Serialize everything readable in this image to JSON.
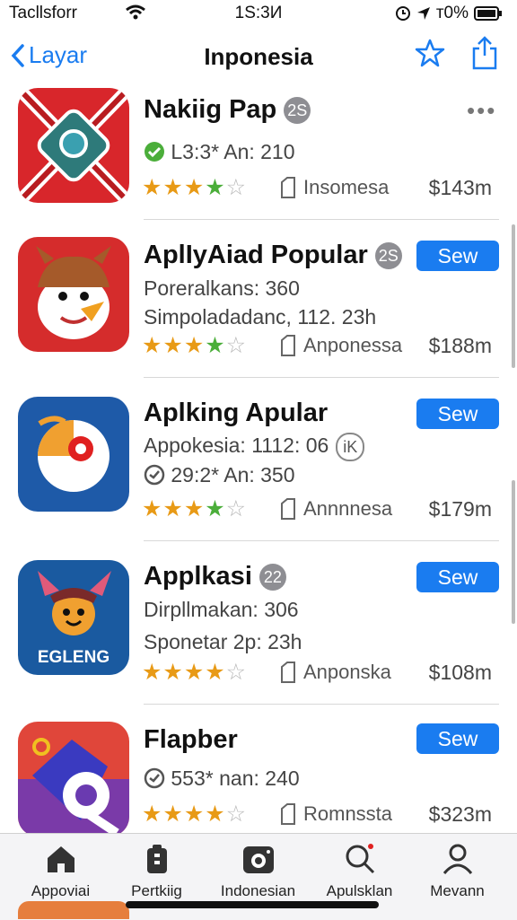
{
  "status": {
    "carrier": "Tacllsforr",
    "time": "1S:3И",
    "battery": "т0%"
  },
  "nav": {
    "back_label": "Layar",
    "title": "Inponesia"
  },
  "apps": [
    {
      "name": "Nakiig Pap",
      "badge": "2S",
      "line1": "L3:3*  An: 210",
      "developer": "Insomesa",
      "price": "$143m",
      "stars": 4
    },
    {
      "name": "AplIyAiad Popular",
      "badge": "2S",
      "line1": "Poreralkans: 360",
      "line2": "Simpoladadanc, 112. 23h",
      "developer": "Anponessa",
      "price": "$188m",
      "stars": 4,
      "get": "Sew"
    },
    {
      "name": "Aplking Apular",
      "badge": "iK",
      "line1": "Appokesia: 1112: 06",
      "line2": "29:2*  An: 350",
      "developer": "Annnnesa",
      "price": "$179m",
      "stars": 4,
      "get": "Sew"
    },
    {
      "name": "Applkasi",
      "badge": "22",
      "line1": "Dirpllmakan: 306",
      "line2": "Sponetar 2p: 23h",
      "developer": "Anponska",
      "price": "$108m",
      "stars": 3.5,
      "get": "Sew",
      "icon_text": "EGLENG"
    },
    {
      "name": "Flapber",
      "line1": "553*  nan: 240",
      "developer": "Romnssta",
      "price": "$323m",
      "stars": 4,
      "get": "Sew"
    }
  ],
  "tabs": [
    {
      "label": "Appoviai",
      "icon": "home-icon"
    },
    {
      "label": "Pertkiig",
      "icon": "bag-icon"
    },
    {
      "label": "Indonesian",
      "icon": "camera-icon"
    },
    {
      "label": "Apulsklan",
      "icon": "search-icon"
    },
    {
      "label": "Mevann",
      "icon": "person-icon"
    }
  ],
  "colors": {
    "accent": "#1a7cf0",
    "star": "#e89a16",
    "star_green": "#4bae3a"
  }
}
